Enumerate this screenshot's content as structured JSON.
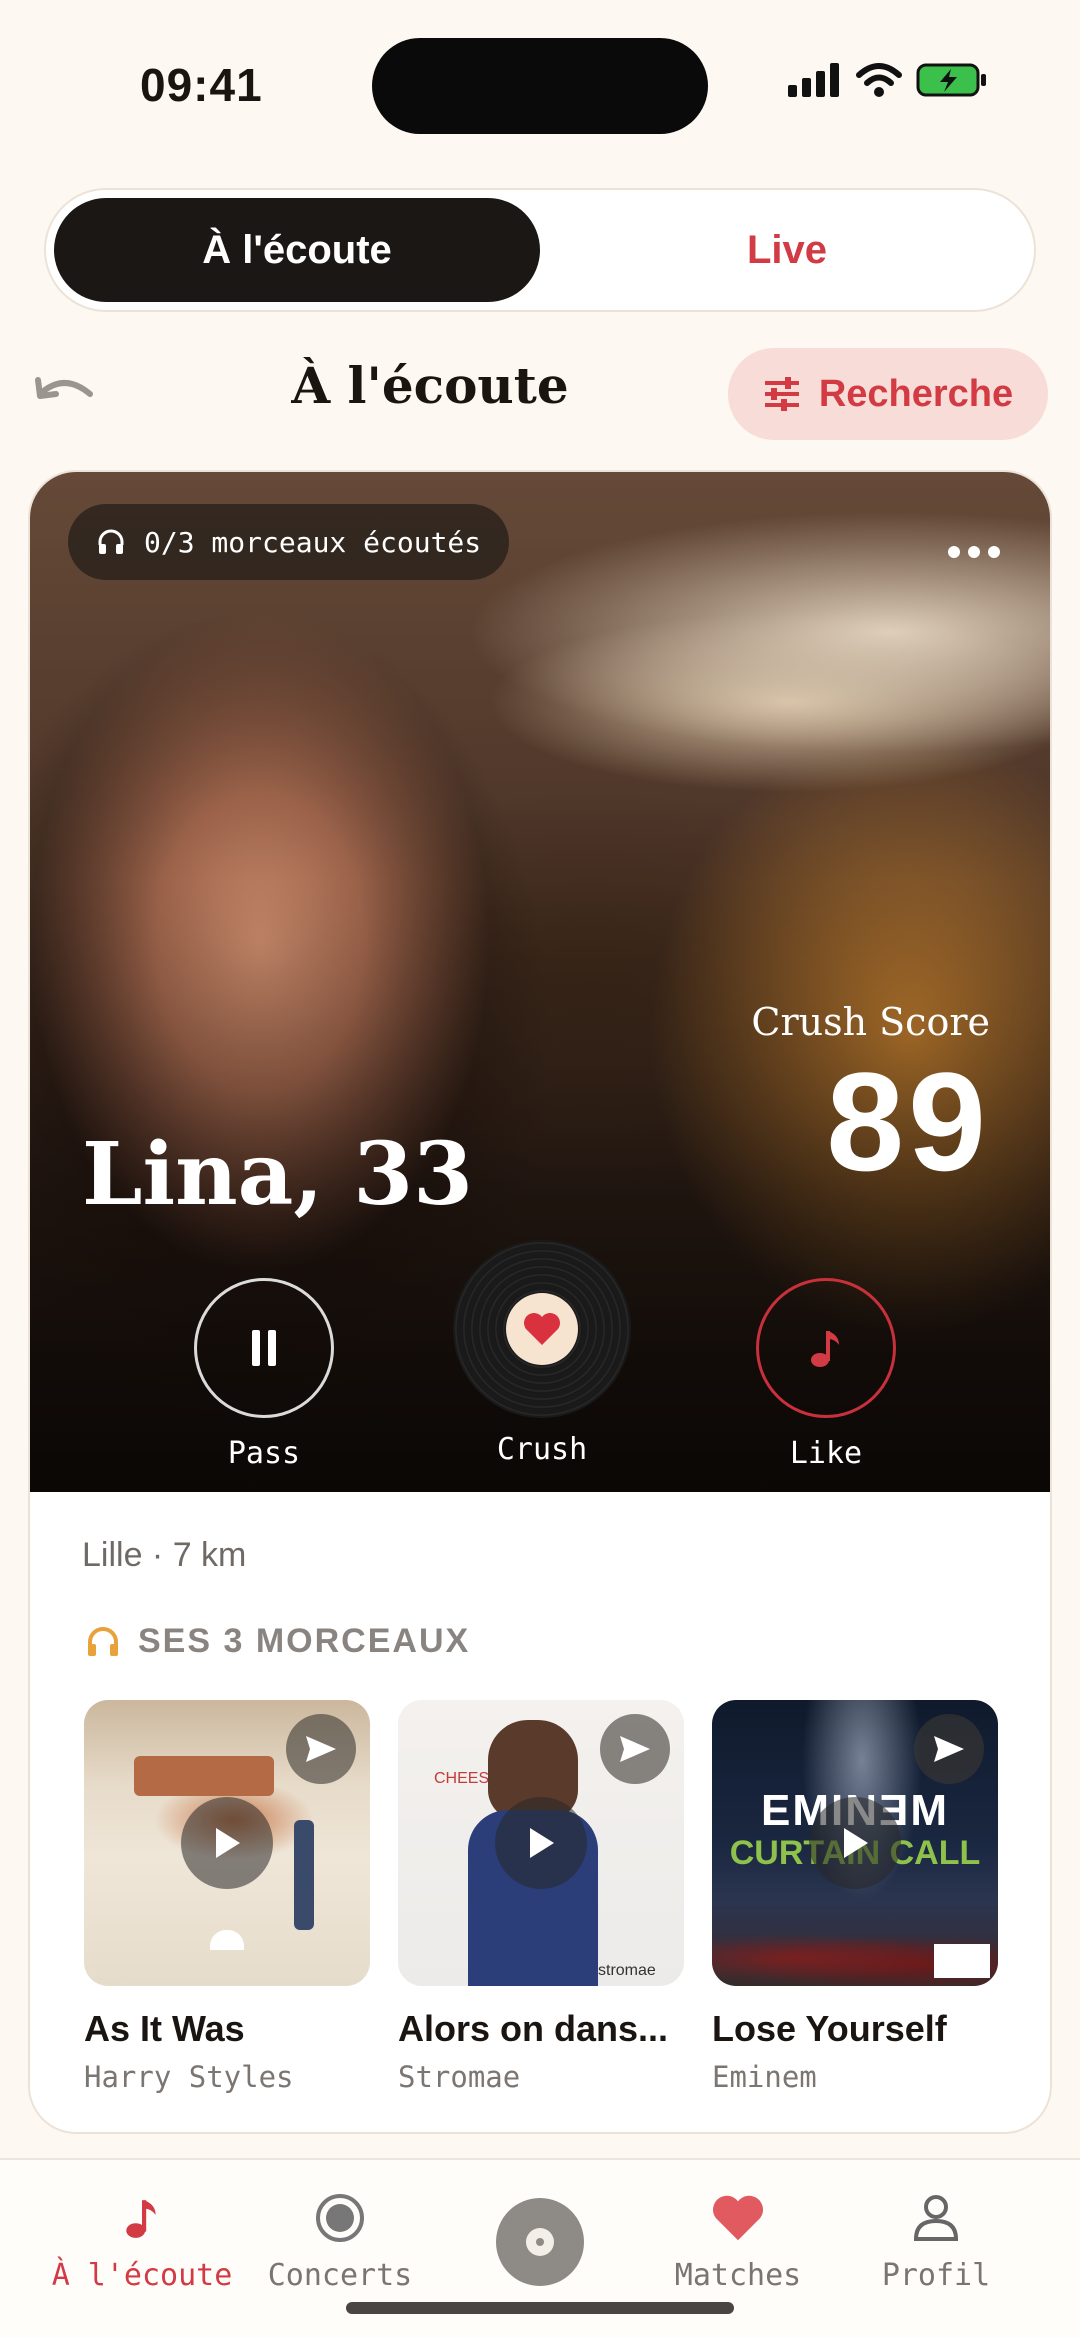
{
  "status": {
    "time": "09:41"
  },
  "segmented": {
    "active": "À l'écoute",
    "other": "Live"
  },
  "header": {
    "title": "À l'écoute",
    "search_label": "Recherche"
  },
  "profile": {
    "listened": "0/3 morceaux écoutés",
    "crush_score_label": "Crush Score",
    "crush_score": "89",
    "name_age": "Lina, 33",
    "location": "Lille · 7 km"
  },
  "actions": {
    "pass": "Pass",
    "crush": "Crush",
    "like": "Like"
  },
  "tracks_section": {
    "heading": "SES 3 MORCEAUX",
    "items": [
      {
        "title": "As It Was",
        "artist": "Harry Styles"
      },
      {
        "title": "Alors on dans...",
        "artist": "Stromae",
        "art_text_a": "CHEESE",
        "art_text_b": "stromae"
      },
      {
        "title": "Lose Yourself",
        "artist": "Eminem",
        "art_text_a": "EMINƎM",
        "art_text_b": "CURTAIN CALL"
      }
    ]
  },
  "tabbar": {
    "items": [
      {
        "label": "À l'écoute",
        "icon": "music-note-icon",
        "active": true
      },
      {
        "label": "Concerts",
        "icon": "record-icon"
      },
      {
        "label": "",
        "icon": "disc-icon"
      },
      {
        "label": "Matches",
        "icon": "heart-icon"
      },
      {
        "label": "Profil",
        "icon": "person-icon"
      }
    ]
  },
  "colors": {
    "accent": "#d23a44",
    "dark": "#1b1714",
    "background": "#fdf8f1"
  }
}
